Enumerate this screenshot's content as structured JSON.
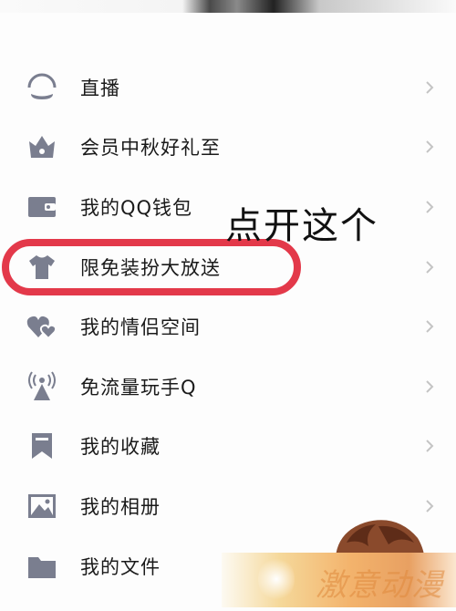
{
  "menu": {
    "items": [
      {
        "label": "直播",
        "icon": "live-icon"
      },
      {
        "label": "会员中秋好礼至",
        "icon": "crown-icon"
      },
      {
        "label": "我的QQ钱包",
        "icon": "wallet-icon"
      },
      {
        "label": "限免装扮大放送",
        "icon": "tshirt-icon"
      },
      {
        "label": "我的情侣空间",
        "icon": "hearts-icon"
      },
      {
        "label": "免流量玩手Q",
        "icon": "signal-tower-icon"
      },
      {
        "label": "我的收藏",
        "icon": "bookmark-icon"
      },
      {
        "label": "我的相册",
        "icon": "photo-album-icon"
      },
      {
        "label": "我的文件",
        "icon": "folder-icon"
      }
    ]
  },
  "annotation": {
    "text": "点开这个",
    "ring_color": "#e3394a"
  },
  "colors": {
    "icon": "#7a7e8f",
    "chevron": "#c4c4c4",
    "text": "#1a1a1a",
    "background": "#fdfdfd"
  },
  "watermark": {
    "text": "激意动漫"
  }
}
